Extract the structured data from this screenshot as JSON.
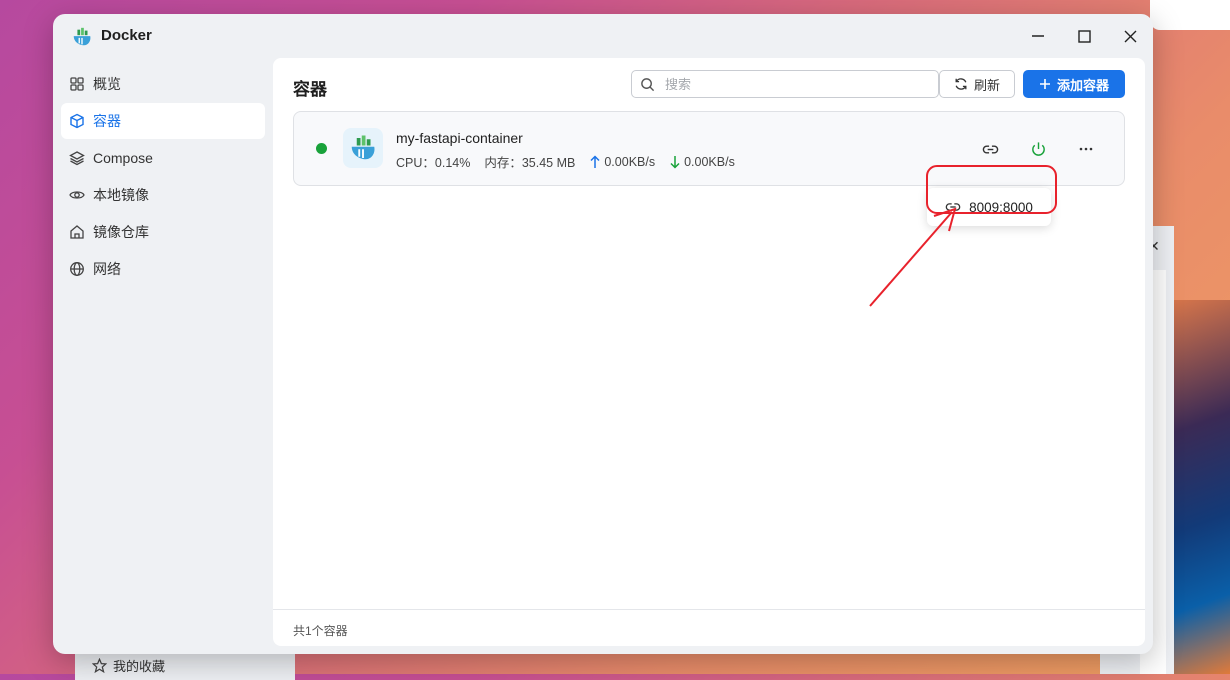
{
  "window": {
    "title": "Docker"
  },
  "sidebar": {
    "items": [
      {
        "label": "概览",
        "icon": "grid-icon",
        "active": false
      },
      {
        "label": "容器",
        "icon": "cube-icon",
        "active": true
      },
      {
        "label": "Compose",
        "icon": "layers-icon",
        "active": false
      },
      {
        "label": "本地镜像",
        "icon": "eye-icon",
        "active": false
      },
      {
        "label": "镜像仓库",
        "icon": "home-icon",
        "active": false
      },
      {
        "label": "网络",
        "icon": "globe-icon",
        "active": false
      }
    ]
  },
  "main": {
    "title": "容器",
    "search_placeholder": "搜索",
    "refresh_label": "刷新",
    "add_label": "添加容器",
    "footer": "共1个容器"
  },
  "container": {
    "name": "my-fastapi-container",
    "status": "running",
    "cpu": "CPU：0.14%",
    "memory": "内存：35.45 MB",
    "upload": "0.00KB/s",
    "download": "0.00KB/s"
  },
  "port_popover": {
    "text": "8009:8000"
  },
  "background": {
    "favorites_label": "我的收藏"
  },
  "colors": {
    "accent": "#1a73e8",
    "running": "#19a23a",
    "annotation": "#e8222c",
    "upload_arrow": "#1a73e8",
    "download_arrow": "#19a23a"
  }
}
